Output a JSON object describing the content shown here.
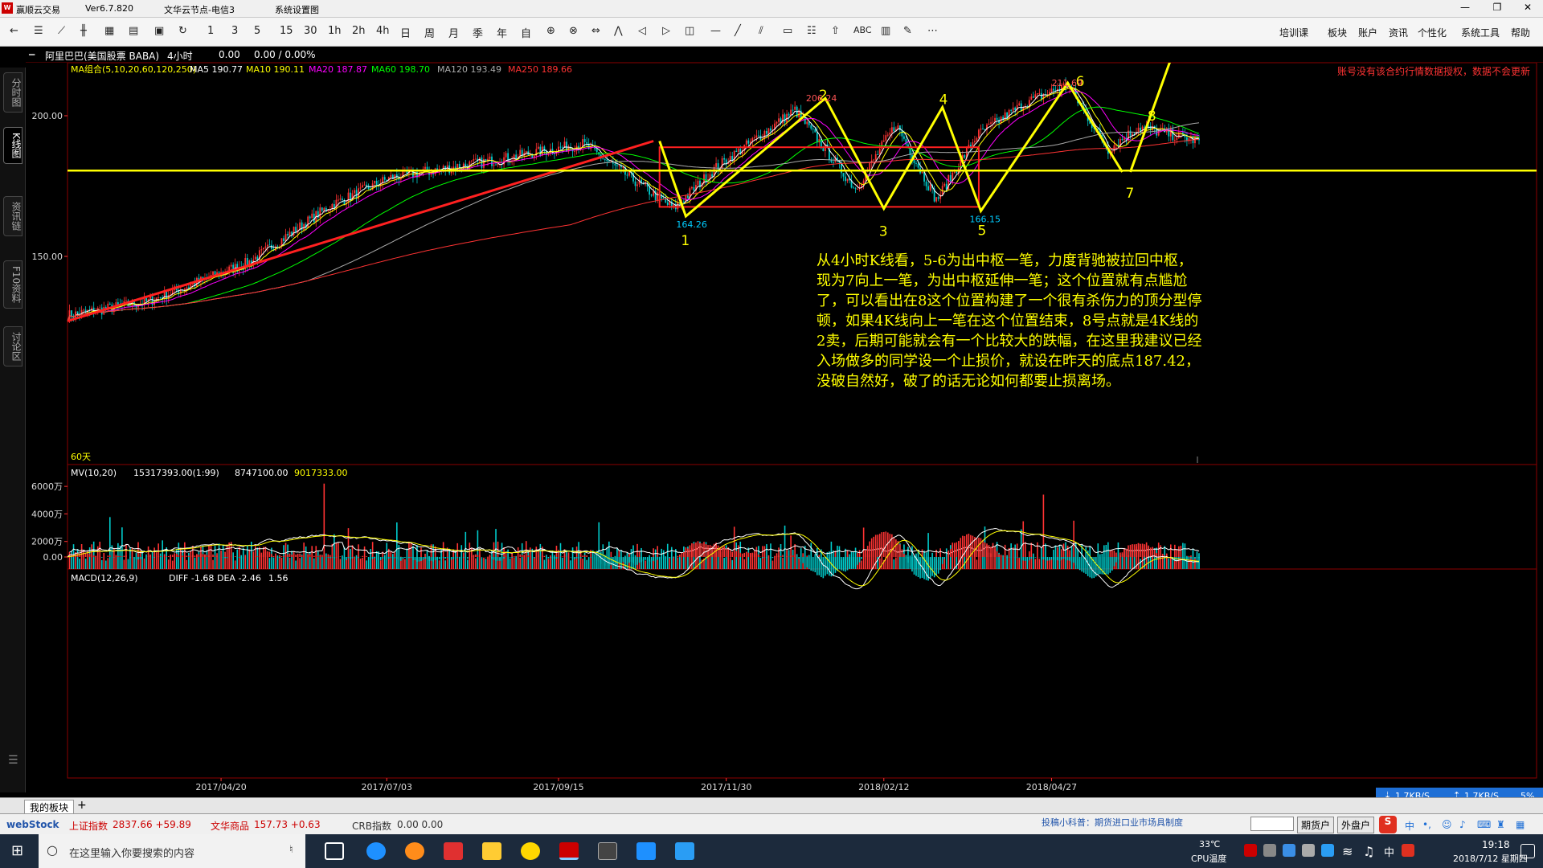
{
  "window": {
    "app_name": "赢顺云交易",
    "version": "Ver6.7.820",
    "server": "文华云节点-电信3",
    "sys_title": "系统设置图"
  },
  "toolbar": {
    "periods": [
      "1",
      "3",
      "5",
      "15",
      "30",
      "1h",
      "2h",
      "4h",
      "日",
      "周",
      "月",
      "季",
      "年",
      "自"
    ],
    "right_menu": [
      "培训课",
      "板块",
      "账户",
      "资讯",
      "个性化",
      "系统工具",
      "帮助"
    ],
    "abc": "ABC"
  },
  "left_tabs": [
    "分时图",
    "K线图",
    "资讯链",
    "F10资料",
    "讨论区"
  ],
  "security": {
    "name": "阿里巴巴(美国股票 BABA)",
    "period": "4小时",
    "v1": "0.00",
    "v2": "0.00 / 0.00%"
  },
  "ma": {
    "label": "MA组合(5,10,20,60,120,250)",
    "items": [
      {
        "text": "MA5 190.77",
        "color": "#ffffff"
      },
      {
        "text": "MA10 190.11",
        "color": "#ffff00"
      },
      {
        "text": "MA20 187.87",
        "color": "#ff00ff"
      },
      {
        "text": "MA60 198.70",
        "color": "#00ff00"
      },
      {
        "text": "MA120 193.49",
        "color": "#aaaaaa"
      },
      {
        "text": "MA250 189.66",
        "color": "#ff3333"
      }
    ]
  },
  "notice": "账号没有该合约行情数据授权，数据不会更新",
  "annotation_lines": [
    "从4小时K线看，5-6为出中枢一笔，力度背驰被拉回中枢，",
    "现为7向上一笔，为出中枢延伸一笔；这个位置就有点尴尬",
    "了，可以看出在8这个位置构建了一个很有杀伤力的顶分型停",
    "顿，如果4K线向上一笔在这个位置结束，8号点就是4K线的",
    "2卖，后期可能就会有一个比较大的跌幅，在这里我建议已经",
    "入场做多的同学设一个止损价，就设在昨天的底点187.42，",
    "没破自然好，破了的话无论如何都要止损离场。"
  ],
  "price_labels": {
    "low1": "164.26",
    "high2": "206.24",
    "low5": "166.15",
    "high6": "211.69"
  },
  "wave_numbers": [
    "1",
    "2",
    "3",
    "4",
    "5",
    "6",
    "7",
    "8"
  ],
  "start_label": "60天",
  "volume": {
    "label": "MV(10,20)",
    "v": "15317393.00(1:99)",
    "ma10": "8747100.00",
    "ma20": "9017333.00",
    "ticks": [
      "6000万",
      "4000万",
      "2000万"
    ]
  },
  "macd": {
    "label": "MACD(12,26,9)",
    "diff": "DIFF -1.68",
    "dea": "DEA -2.46",
    "macd": "1.56",
    "zero": "0.00"
  },
  "chart_data": {
    "type": "candlestick",
    "title": "阿里巴巴(美国股票 BABA) 4小时",
    "y_ticks": [
      200.0,
      150.0
    ],
    "x_ticks": [
      "2017/04/20",
      "2017/07/03",
      "2017/09/15",
      "2017/11/30",
      "2018/02/12",
      "2018/04/27"
    ],
    "close_path": {
      "x_index": [
        0,
        40,
        90,
        130,
        160,
        210,
        255,
        300,
        320,
        360,
        390,
        410,
        430,
        450,
        475,
        495,
        515,
        530,
        560
      ],
      "price": [
        129,
        134,
        148,
        168,
        178,
        184,
        190,
        167,
        181,
        202,
        174,
        197,
        170,
        193,
        205,
        211,
        188,
        196,
        191
      ]
    },
    "strokes": {
      "points": [
        {
          "label": "1",
          "price": 164.26
        },
        {
          "label": "2",
          "price": 206.24
        },
        {
          "label": "3",
          "price": 167.0
        },
        {
          "label": "4",
          "price": 203.0
        },
        {
          "label": "5",
          "price": 166.15
        },
        {
          "label": "6",
          "price": 211.69
        },
        {
          "label": "7",
          "price": 187.42
        },
        {
          "label": "8",
          "price": 196.0
        }
      ]
    },
    "pivot_box": {
      "high": 188.8,
      "low": 167.6
    },
    "horizontal_line": 180.5,
    "macd_range": [
      -35,
      35
    ],
    "volume_max_wan": 7000
  },
  "bottom": {
    "tab": "我的板块",
    "plus": "+",
    "ticker": [
      {
        "text": "上证指数",
        "color": "#cc0000"
      },
      {
        "text": "2837.66 +59.89",
        "color": "#cc0000"
      },
      {
        "text": "文华商品",
        "color": "#cc0000"
      },
      {
        "text": "157.73 +0.63",
        "color": "#cc0000"
      },
      {
        "text": "CRB指数",
        "color": "#333333"
      },
      {
        "text": "0.00 0.00",
        "color": "#333333"
      }
    ],
    "scroll_news": "投稿小科普：期货进口业市场具制度",
    "btn_futures": "期货户",
    "btn_fx": "外盘户",
    "netspeed_down": "1.7KB/S",
    "netspeed_up": "1.7KB/S",
    "netspeed_pct": "5%"
  },
  "taskbar": {
    "search_placeholder": "在这里输入你要搜索的内容",
    "temp": "33℃",
    "cpu": "CPU温度",
    "time": "19:18",
    "date": "2018/7/12 星期四",
    "ime": "中"
  },
  "colors": {
    "up": "#ff3333",
    "down": "#00cccc",
    "yellow": "#ffff00",
    "grid_border": "#8b0000"
  }
}
